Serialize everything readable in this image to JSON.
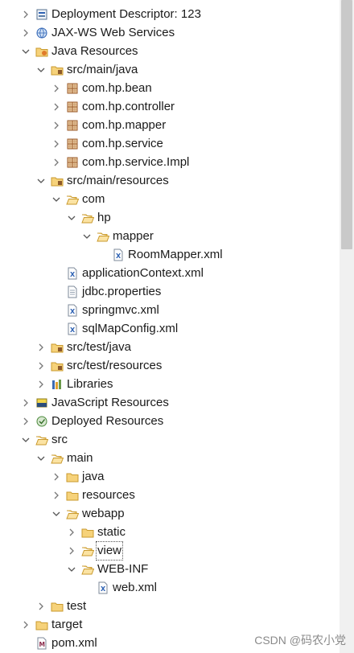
{
  "tree": [
    {
      "label": "Deployment Descriptor: 123",
      "icon": "deployment-descriptor-icon",
      "twisty": "collapsed",
      "level": 0
    },
    {
      "label": "JAX-WS Web Services",
      "icon": "web-services-icon",
      "twisty": "collapsed",
      "level": 0
    },
    {
      "label": "Java Resources",
      "icon": "java-resources-icon",
      "twisty": "expanded",
      "level": 0
    },
    {
      "label": "src/main/java",
      "icon": "source-folder-icon",
      "twisty": "expanded",
      "level": 1
    },
    {
      "label": "com.hp.bean",
      "icon": "package-icon",
      "twisty": "collapsed",
      "level": 2
    },
    {
      "label": "com.hp.controller",
      "icon": "package-icon",
      "twisty": "collapsed",
      "level": 2
    },
    {
      "label": "com.hp.mapper",
      "icon": "package-icon",
      "twisty": "collapsed",
      "level": 2
    },
    {
      "label": "com.hp.service",
      "icon": "package-icon",
      "twisty": "collapsed",
      "level": 2
    },
    {
      "label": "com.hp.service.Impl",
      "icon": "package-icon",
      "twisty": "collapsed",
      "level": 2
    },
    {
      "label": "src/main/resources",
      "icon": "source-folder-icon",
      "twisty": "expanded",
      "level": 1
    },
    {
      "label": "com",
      "icon": "folder-open-icon",
      "twisty": "expanded",
      "level": 2
    },
    {
      "label": "hp",
      "icon": "folder-open-icon",
      "twisty": "expanded",
      "level": 3
    },
    {
      "label": "mapper",
      "icon": "folder-open-icon",
      "twisty": "expanded",
      "level": 4
    },
    {
      "label": "RoomMapper.xml",
      "icon": "xml-file-icon",
      "twisty": "none",
      "level": 5
    },
    {
      "label": "applicationContext.xml",
      "icon": "xml-file-icon",
      "twisty": "none",
      "level": 2
    },
    {
      "label": "jdbc.properties",
      "icon": "properties-file-icon",
      "twisty": "none",
      "level": 2
    },
    {
      "label": "springmvc.xml",
      "icon": "xml-file-icon",
      "twisty": "none",
      "level": 2
    },
    {
      "label": "sqlMapConfig.xml",
      "icon": "xml-file-icon",
      "twisty": "none",
      "level": 2
    },
    {
      "label": "src/test/java",
      "icon": "source-folder-icon",
      "twisty": "collapsed",
      "level": 1
    },
    {
      "label": "src/test/resources",
      "icon": "source-folder-icon",
      "twisty": "collapsed",
      "level": 1
    },
    {
      "label": "Libraries",
      "icon": "libraries-icon",
      "twisty": "collapsed",
      "level": 1
    },
    {
      "label": "JavaScript Resources",
      "icon": "javascript-resources-icon",
      "twisty": "collapsed",
      "level": 0
    },
    {
      "label": "Deployed Resources",
      "icon": "deployed-resources-icon",
      "twisty": "collapsed",
      "level": 0
    },
    {
      "label": "src",
      "icon": "folder-open-icon",
      "twisty": "expanded",
      "level": 0
    },
    {
      "label": "main",
      "icon": "folder-open-icon",
      "twisty": "expanded",
      "level": 1
    },
    {
      "label": "java",
      "icon": "folder-icon",
      "twisty": "collapsed",
      "level": 2
    },
    {
      "label": "resources",
      "icon": "folder-icon",
      "twisty": "collapsed",
      "level": 2
    },
    {
      "label": "webapp",
      "icon": "folder-open-icon",
      "twisty": "expanded",
      "level": 2
    },
    {
      "label": "static",
      "icon": "folder-icon",
      "twisty": "collapsed",
      "level": 3
    },
    {
      "label": "view",
      "icon": "folder-open-icon",
      "twisty": "collapsed",
      "level": 3,
      "selected": true
    },
    {
      "label": "WEB-INF",
      "icon": "folder-open-icon",
      "twisty": "expanded",
      "level": 3
    },
    {
      "label": "web.xml",
      "icon": "xml-file-icon",
      "twisty": "none",
      "level": 4
    },
    {
      "label": "test",
      "icon": "folder-icon",
      "twisty": "collapsed",
      "level": 1
    },
    {
      "label": "target",
      "icon": "folder-icon",
      "twisty": "collapsed",
      "level": 0
    },
    {
      "label": "pom.xml",
      "icon": "maven-pom-icon",
      "twisty": "none",
      "level": 0
    }
  ],
  "watermark": "CSDN @码农小党",
  "colors": {
    "folder": "#e8b64c",
    "package": "#9a5a2a",
    "xml": "#2f63b4",
    "chevron": "#6b6b6b"
  }
}
